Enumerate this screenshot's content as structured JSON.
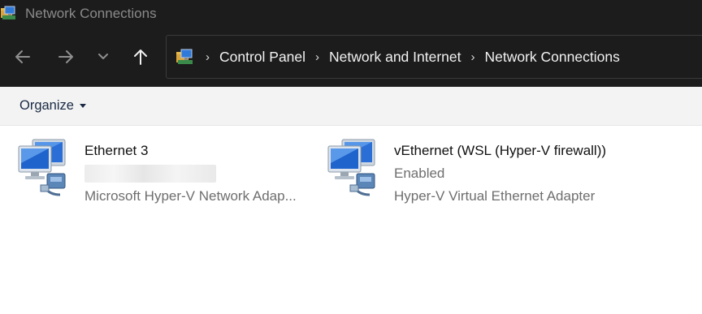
{
  "window": {
    "title": "Network Connections"
  },
  "navigation": {
    "breadcrumb": [
      "Control Panel",
      "Network and Internet",
      "Network Connections"
    ]
  },
  "toolbar": {
    "organize_label": "Organize"
  },
  "connections": [
    {
      "name": "Ethernet 3",
      "status": "",
      "device": "Microsoft Hyper-V Network Adap..."
    },
    {
      "name": "vEthernet (WSL (Hyper-V firewall))",
      "status": "Enabled",
      "device": "Hyper-V Virtual Ethernet Adapter"
    }
  ],
  "icons": {
    "window": "network-folder-icon",
    "back": "arrow-left-icon",
    "forward": "arrow-right-icon",
    "recent": "chevron-down-icon",
    "up": "arrow-up-icon",
    "separator": "chevron-right-icon",
    "connection": "network-connection-icon"
  },
  "colors": {
    "titlebar": "#1c1c1c",
    "commandbar": "#f3f3f3",
    "secondary_text": "#6e6e6e"
  }
}
